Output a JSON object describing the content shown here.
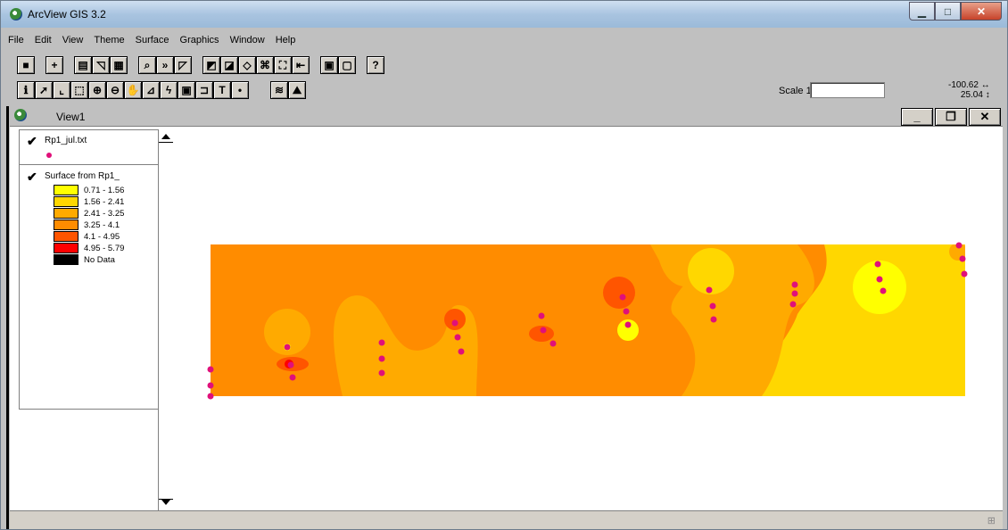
{
  "app": {
    "title": "ArcView GIS 3.2"
  },
  "menus": [
    "File",
    "Edit",
    "View",
    "Theme",
    "Surface",
    "Graphics",
    "Window",
    "Help"
  ],
  "toolbar1_icons": [
    "save-icon",
    "add-theme-icon",
    "theme-properties-icon",
    "edit-legend-icon",
    "open-table-icon",
    "find-icon",
    "query-builder-icon",
    "select-by-theme-icon",
    "create-surface-icon",
    "create-contours-icon",
    "hillshade-icon",
    "zoom-full-icon",
    "zoom-active-icon",
    "zoom-previous-icon",
    "layout-icon",
    "print-icon",
    "help-icon"
  ],
  "toolbar2_icons": [
    "identify-icon",
    "pointer-icon",
    "vertex-edit-icon",
    "select-feature-icon",
    "zoom-in-icon",
    "zoom-out-icon",
    "pan-icon",
    "measure-icon",
    "hotlink-icon",
    "area-of-interest-icon",
    "label-icon",
    "text-icon",
    "draw-point-icon",
    "contour-tool-icon",
    "profile-tool-icon"
  ],
  "scale": {
    "label": "Scale 1:",
    "value": ""
  },
  "coords": {
    "x": "-100.62",
    "y": "25.04"
  },
  "view": {
    "title": "View1"
  },
  "toc": {
    "theme1": {
      "name": "Rp1_jul.txt",
      "point_color": "#e0107a"
    },
    "theme2": {
      "name": "Surface from Rp1_",
      "legend": [
        {
          "label": "0.71 - 1.56",
          "color": "#ffff00"
        },
        {
          "label": "1.56 - 2.41",
          "color": "#ffd700"
        },
        {
          "label": "2.41 - 3.25",
          "color": "#ffaa00"
        },
        {
          "label": "3.25 - 4.1",
          "color": "#ff8c00"
        },
        {
          "label": "4.1 - 4.95",
          "color": "#ff5500"
        },
        {
          "label": "4.95 - 5.79",
          "color": "#ff0000"
        },
        {
          "label": "No Data",
          "color": "#000000"
        }
      ]
    }
  },
  "colors": {
    "accent": "#e0107a",
    "titlebar": "#a9c4e0"
  }
}
